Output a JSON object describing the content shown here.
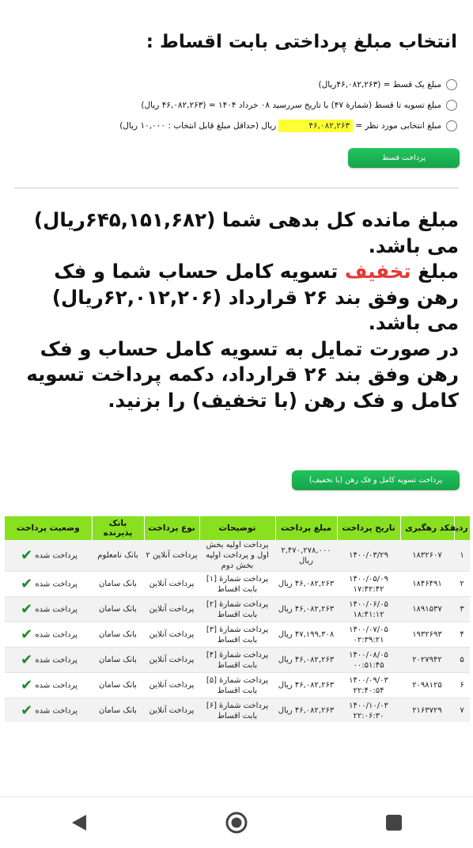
{
  "title": "انتخاب مبلغ پرداختی بابت اقساط :",
  "options": [
    {
      "text": "مبلغ یک قسط = (۴۶,۰۸۲,۲۶۳ریال)",
      "selected": false
    },
    {
      "text": "مبلغ تسویه تا قسط (شمارهٔ ۴۷) با تاریخ سررسید ۰۸ خرداد ۱۴۰۴ = (۴۶,۰۸۲,۲۶۳ ریال)",
      "selected": false
    },
    {
      "prefix": "مبلغ انتخابی مورد نظر =",
      "input_value": "۴۶,۰۸۲,۲۶۳",
      "suffix": "ریال (حداقل مبلغ قابل انتخاب : ۱۰,۰۰۰ ریال)",
      "selected": false
    }
  ],
  "pay_installment_button": "پرداخت قسط",
  "message": {
    "line1": "مبلغ مانده کل بدهی شما (۶۴۵,۱۵۱,۶۸۲ریال) می باشد.",
    "line2_before": "مبلغ ",
    "line2_discount_word": "تخفیف",
    "line2_after": " تسویه کامل حساب شما و فک رهن وفق بند ۲۶ قرارداد (۶۲,۰۱۲,۲۰۶ریال) می باشد.",
    "line3": "در صورت تمایل به تسویه کامل حساب و فک رهن وفق بند ۲۶ قرارداد، دکمه پرداخت تسویه کامل و فک رهن (با تخفیف) را بزنید."
  },
  "full_settlement_button": "پرداخت تسویه کامل و فک رهن (با تخفیف)",
  "table": {
    "headers": [
      "ردیف",
      "کد رهگیری",
      "تاریخ پرداخت",
      "مبلغ پرداخت",
      "توضیحات",
      "نوع پرداخت",
      "بانک پذیرنده",
      "وضعیت پرداخت"
    ],
    "rows": [
      [
        "۱",
        "۱۸۳۲۶۰۷",
        "۱۴۰۰/۰۳/۲۹",
        "۲,۴۷۰,۲۷۸,۰۰۰ ریال",
        "پرداخت اولیه بخش اول و پرداخت اولیه بخش دوم",
        "پرداخت آنلاین ۲",
        "بانک نامعلوم",
        "پرداخت شده"
      ],
      [
        "۲",
        "۱۸۴۶۴۹۱",
        "۱۴۰۰/۰۵/۰۹ ۱۷:۴۲:۴۲",
        "۴۶,۰۸۲,۲۶۳ ریال",
        "پرداخت شمارهٔ [۱] بابت اقساط",
        "پرداخت آنلاین",
        "بانک سامان",
        "پرداخت شده"
      ],
      [
        "۳",
        "۱۸۹۱۵۳۷",
        "۱۴۰۰/۰۶/۰۵ ۱۸:۴۱:۱۲",
        "۴۶,۰۸۲,۲۶۳ ریال",
        "پرداخت شمارهٔ [۲] بابت اقساط",
        "پرداخت آنلاین",
        "بانک سامان",
        "پرداخت شده"
      ],
      [
        "۴",
        "۱۹۳۲۶۹۳",
        "۱۴۰۰/۰۷/۰۵ ۰۲:۳۹:۲۱",
        "۴۷,۱۹۹,۳۰۸ ریال",
        "پرداخت شمارهٔ [۳] بابت اقساط",
        "پرداخت آنلاین",
        "بانک سامان",
        "پرداخت شده"
      ],
      [
        "۵",
        "۲۰۲۷۹۴۲",
        "۱۴۰۰/۰۸/۰۵ ۰۰:۵۱:۴۵",
        "۴۶,۰۸۲,۲۶۳ ریال",
        "پرداخت شمارهٔ [۴] بابت اقساط",
        "پرداخت آنلاین",
        "بانک سامان",
        "پرداخت شده"
      ],
      [
        "۶",
        "۲۰۹۸۱۲۵",
        "۱۴۰۰/۰۹/۰۳ ۲۲:۴۰:۵۴",
        "۴۶,۰۸۲,۲۶۳ ریال",
        "پرداخت شمارهٔ [۵] بابت اقساط",
        "پرداخت آنلاین",
        "بانک سامان",
        "پرداخت شده"
      ],
      [
        "۷",
        "۲۱۶۳۷۲۹",
        "۱۴۰۰/۱۰/۰۳ ۲۲:۰۶:۳۰",
        "۴۶,۰۸۲,۲۶۳ ریال",
        "پرداخت شمارهٔ [۶] بابت اقساط",
        "پرداخت آنلاین",
        "بانک سامان",
        "پرداخت شده"
      ]
    ]
  },
  "navbar": {
    "icons": [
      "back-triangle-icon",
      "home-circle-icon",
      "recents-square-icon"
    ]
  },
  "colors": {
    "accent_green": "#16a34a",
    "table_header": "#88e021",
    "highlight": "#ffff33",
    "discount_red": "#e53935"
  }
}
